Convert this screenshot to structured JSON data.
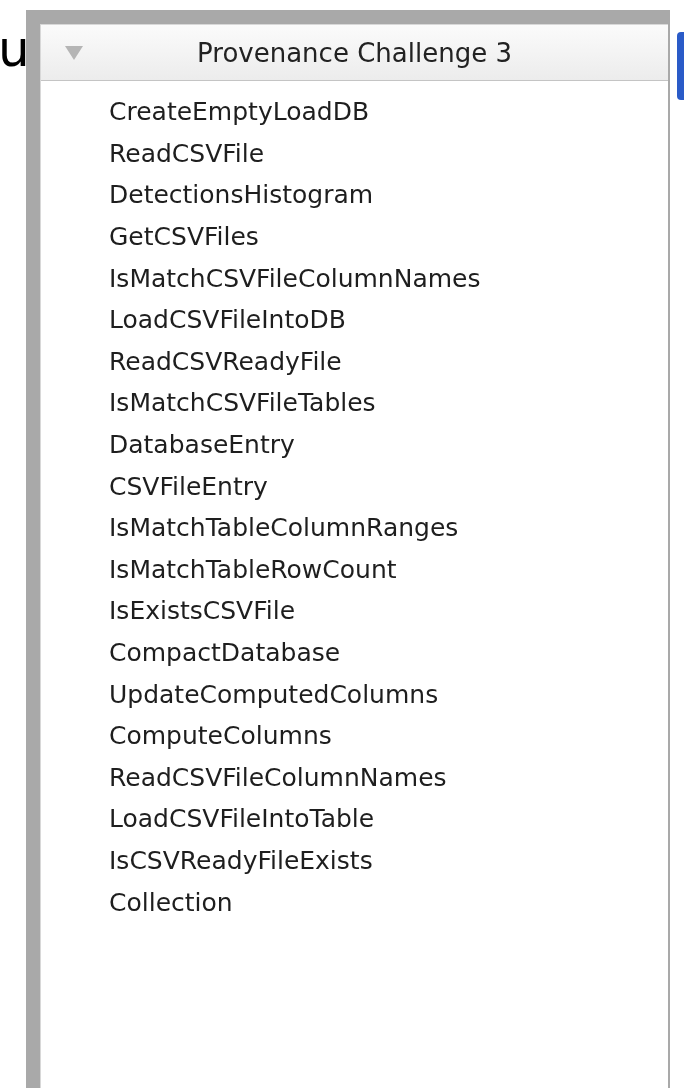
{
  "background_text": "u",
  "panel": {
    "title": "Provenance Challenge 3",
    "expanded": true,
    "items": [
      "CreateEmptyLoadDB",
      "ReadCSVFile",
      "DetectionsHistogram",
      "GetCSVFiles",
      "IsMatchCSVFileColumnNames",
      "LoadCSVFileIntoDB",
      "ReadCSVReadyFile",
      "IsMatchCSVFileTables",
      "DatabaseEntry",
      "CSVFileEntry",
      "IsMatchTableColumnRanges",
      "IsMatchTableRowCount",
      "IsExistsCSVFile",
      "CompactDatabase",
      "UpdateComputedColumns",
      "ComputeColumns",
      "ReadCSVFileColumnNames",
      "LoadCSVFileIntoTable",
      "IsCSVReadyFileExists",
      "Collection"
    ]
  }
}
